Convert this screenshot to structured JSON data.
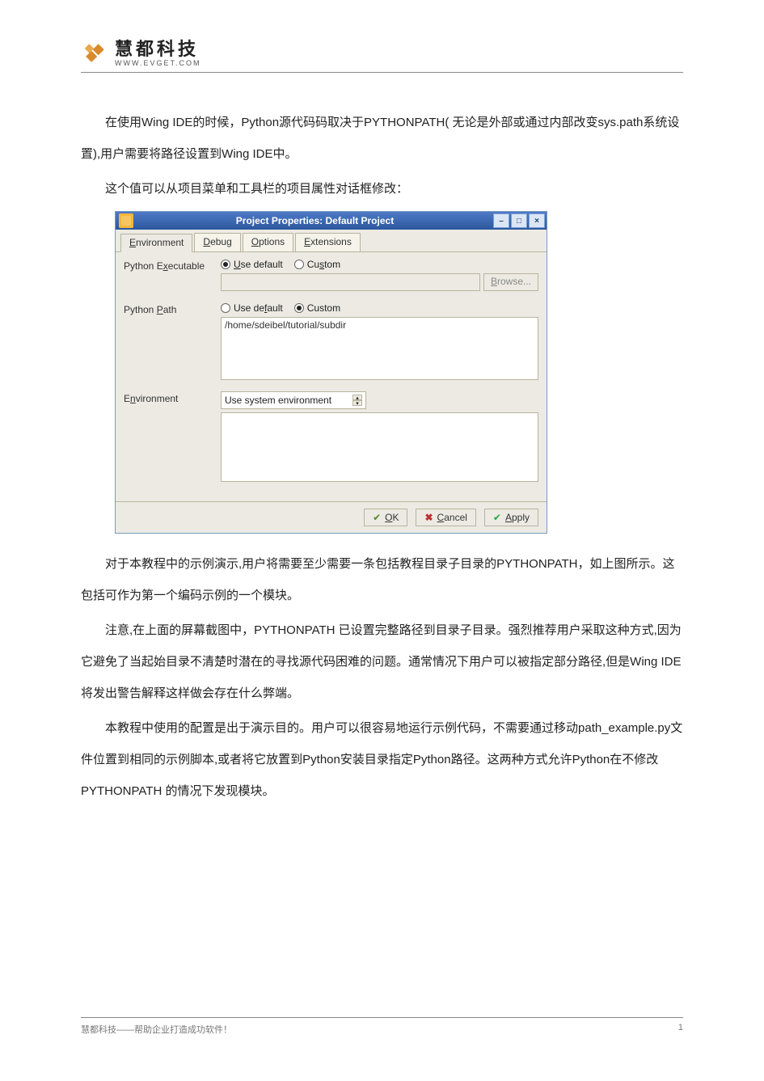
{
  "header": {
    "logo_cn": "慧都科技",
    "logo_en": "WWW.EVGET.COM"
  },
  "paragraphs": {
    "p1": "在使用Wing IDE的时候，Python源代码码取决于PYTHONPATH( 无论是外部或通过内部改变sys.path系统设置),用户需要将路径设置到Wing IDE中。",
    "p2": "这个值可以从项目菜单和工具栏的项目属性对话框修改：",
    "p3": "对于本教程中的示例演示,用户将需要至少需要一条包括教程目录子目录的PYTHONPATH，如上图所示。这包括可作为第一个编码示例的一个模块。",
    "p4": "注意,在上面的屏幕截图中，PYTHONPATH 已设置完整路径到目录子目录。强烈推荐用户采取这种方式,因为它避免了当起始目录不清楚时潜在的寻找源代码困难的问题。通常情况下用户可以被指定部分路径,但是Wing IDE将发出警告解释这样做会存在什么弊端。",
    "p5": "本教程中使用的配置是出于演示目的。用户可以很容易地运行示例代码，不需要通过移动path_example.py文件位置到相同的示例脚本,或者将它放置到Python安装目录指定Python路径。这两种方式允许Python在不修改PYTHONPATH 的情况下发现模块。"
  },
  "dialog": {
    "title": "Project Properties: Default Project",
    "tabs": [
      "Environment",
      "Debug",
      "Options",
      "Extensions"
    ],
    "python_exec_label": "Python Executable",
    "python_path_label": "Python Path",
    "environment_label": "Environment",
    "radio_use_default": "Use default",
    "radio_custom": "Custom",
    "browse": "Browse...",
    "path_value": "/home/sdeibel/tutorial/subdir",
    "env_combo": "Use system environment",
    "ok": "OK",
    "cancel": "Cancel",
    "apply": "Apply"
  },
  "footer": {
    "left": "慧都科技——帮助企业打造成功软件！",
    "page": "1"
  }
}
